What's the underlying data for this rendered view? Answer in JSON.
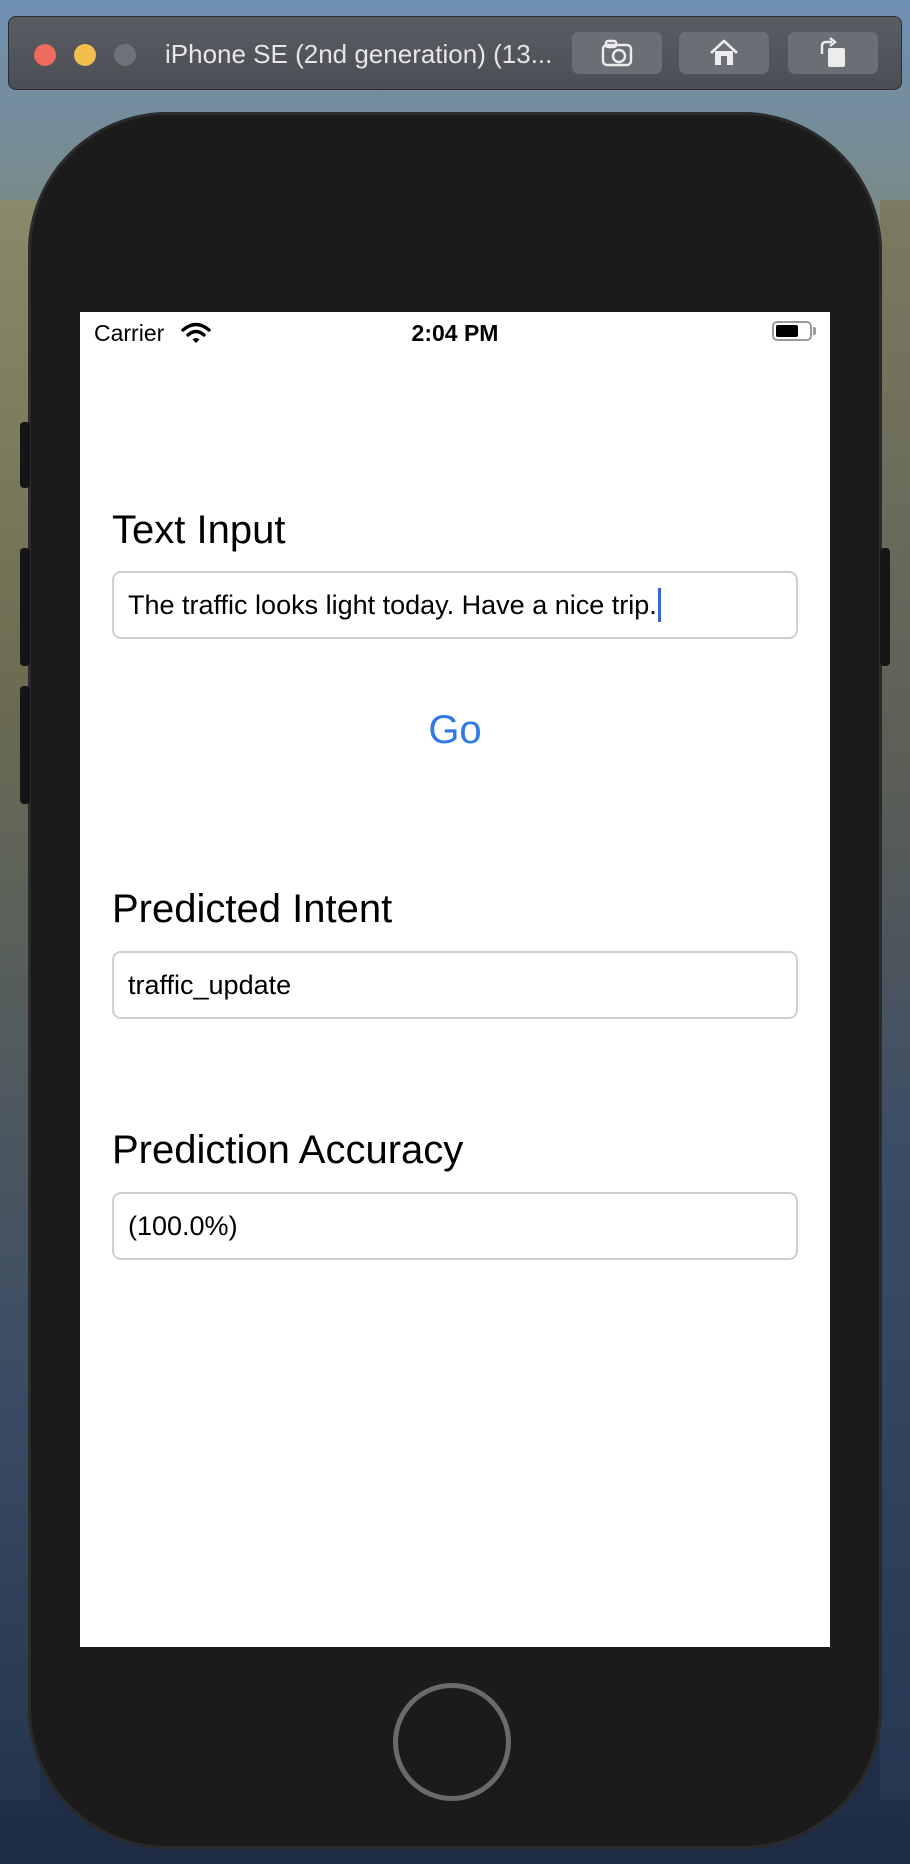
{
  "window": {
    "title": "iPhone SE (2nd generation) (13..."
  },
  "toolbar": {
    "screenshot_icon": "camera-icon",
    "home_icon": "home-icon",
    "rotate_icon": "rotate-icon"
  },
  "status_bar": {
    "carrier": "Carrier",
    "time": "2:04 PM",
    "battery_level": 0.7
  },
  "form": {
    "text_input_label": "Text Input",
    "text_input_value": "The traffic looks light today. Have a nice trip.",
    "go_label": "Go",
    "predicted_intent_label": "Predicted Intent",
    "predicted_intent_value": "traffic_update",
    "accuracy_label": "Prediction Accuracy",
    "accuracy_value": "(100.0%)"
  },
  "colors": {
    "accent": "#2f7ae5",
    "caret": "#3a66d8"
  }
}
